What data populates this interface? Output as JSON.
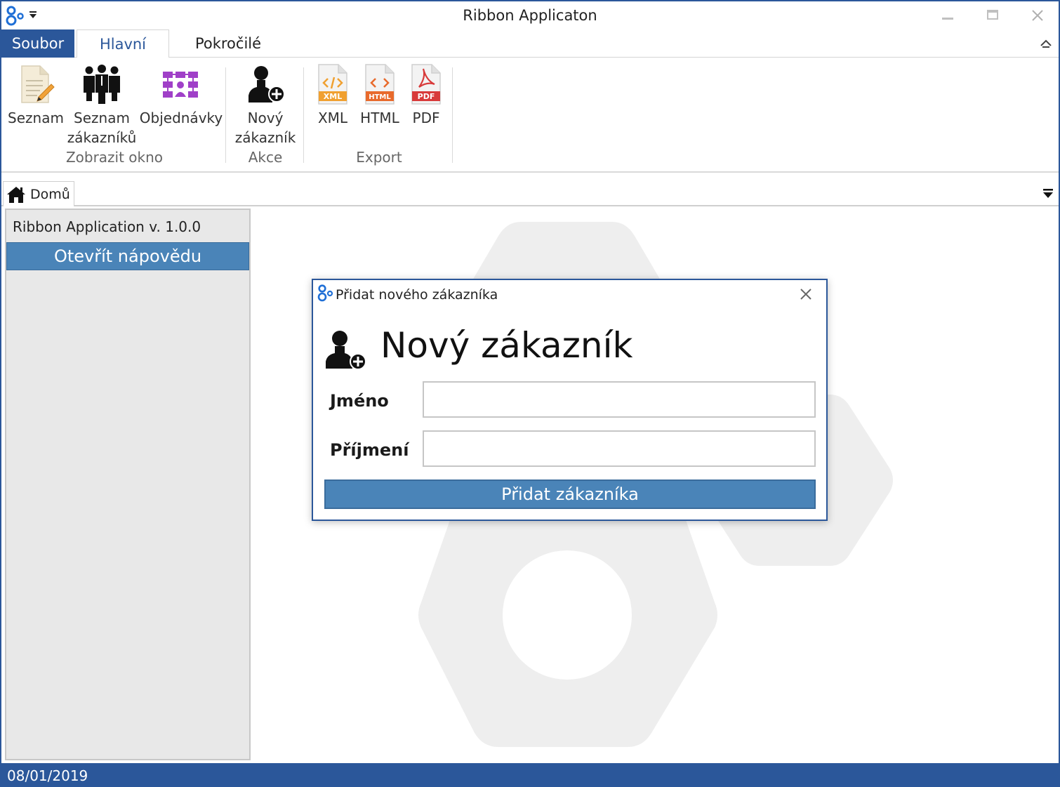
{
  "window": {
    "title": "Ribbon Applicaton"
  },
  "ribbon": {
    "tabs": [
      {
        "label": "Soubor"
      },
      {
        "label": "Hlavní"
      },
      {
        "label": "Pokročilé"
      }
    ],
    "groups": [
      {
        "label": "Zobrazit okno",
        "buttons": [
          {
            "label": "Seznam",
            "icon": "document-edit-icon"
          },
          {
            "label": "Seznam zákazníků",
            "line1": "Seznam",
            "line2": "zákazníků",
            "icon": "customers-group-icon"
          },
          {
            "label": "Objednávky",
            "icon": "orders-network-icon"
          }
        ]
      },
      {
        "label": "Akce",
        "buttons": [
          {
            "label": "Nový zákazník",
            "line1": "Nový",
            "line2": "zákazník",
            "icon": "add-user-icon"
          }
        ]
      },
      {
        "label": "Export",
        "buttons": [
          {
            "label": "XML",
            "icon": "xml-file-icon",
            "badge": "XML"
          },
          {
            "label": "HTML",
            "icon": "html-file-icon",
            "badge": "HTML"
          },
          {
            "label": "PDF",
            "icon": "pdf-file-icon",
            "badge": "PDF"
          }
        ]
      }
    ]
  },
  "document_tabs": [
    {
      "label": "Domů",
      "icon": "home-icon"
    }
  ],
  "side_panel": {
    "version": "Ribbon Application v. 1.0.0",
    "help_button": "Otevřít nápovědu"
  },
  "dialog": {
    "title": "Přidat nového zákazníka",
    "heading": "Nový zákazník",
    "fields": [
      {
        "label": "Jméno",
        "value": "",
        "placeholder": ""
      },
      {
        "label": "Příjmení",
        "value": "",
        "placeholder": ""
      }
    ],
    "submit_label": "Přidat zákazníka"
  },
  "status_bar": {
    "date": "08/01/2019"
  },
  "colors": {
    "accent": "#2b579a",
    "button_blue": "#4a84b8",
    "orders_purple": "#a040c8",
    "xml_orange": "#f0a030",
    "html_orange": "#e86a2c",
    "pdf_red": "#d83a3a"
  }
}
